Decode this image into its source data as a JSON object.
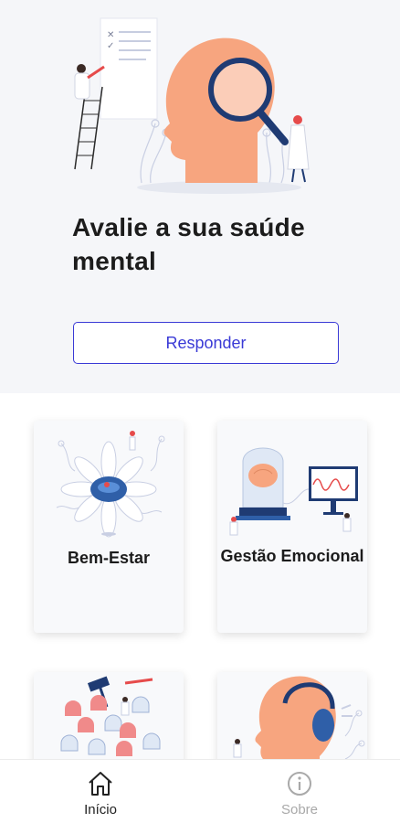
{
  "hero": {
    "title": "Avalie a sua saúde mental",
    "button_label": "Responder"
  },
  "cards": [
    {
      "label": "Bem-Estar"
    },
    {
      "label": "Gestão Emocional"
    },
    {
      "label": ""
    },
    {
      "label": ""
    }
  ],
  "bottom_nav": {
    "items": [
      {
        "label": "Início",
        "icon": "home-icon",
        "active": true
      },
      {
        "label": "Sobre",
        "icon": "info-icon",
        "active": false
      }
    ]
  },
  "colors": {
    "accent": "#3a3ad6",
    "peach": "#f7a57f",
    "navy": "#1f3b73",
    "hero_bg": "#f5f6f9"
  }
}
